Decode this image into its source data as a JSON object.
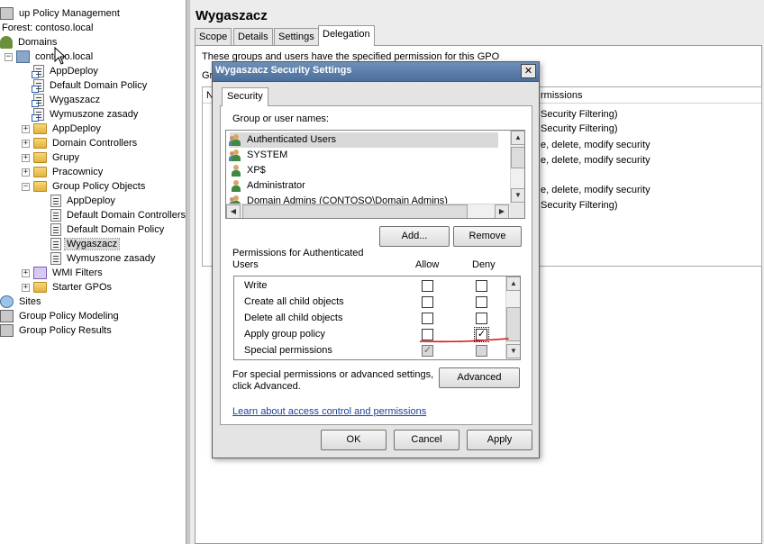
{
  "tree": [
    {
      "label": "up Policy Management",
      "icon": "gpm-icon",
      "expander": "",
      "indent": 0
    },
    {
      "label": "Forest: contoso.local",
      "icon": "",
      "expander": "",
      "indent": 0
    },
    {
      "label": "Domains",
      "icon": "domains-icon",
      "expander": "",
      "indent": 0
    },
    {
      "label": "contoso.local",
      "icon": "domain-icon",
      "expander": "−",
      "indent": 1
    },
    {
      "label": "AppDeploy",
      "icon": "gpo-link-icon",
      "expander": "",
      "indent": 2
    },
    {
      "label": "Default Domain Policy",
      "icon": "gpo-link-icon",
      "expander": "",
      "indent": 2
    },
    {
      "label": "Wygaszacz",
      "icon": "gpo-link-icon",
      "expander": "",
      "indent": 2
    },
    {
      "label": "Wymuszone zasady",
      "icon": "gpo-link-icon",
      "expander": "",
      "indent": 2
    },
    {
      "label": "AppDeploy",
      "icon": "folder-icon",
      "expander": "+",
      "indent": 2
    },
    {
      "label": "Domain Controllers",
      "icon": "folder-icon",
      "expander": "+",
      "indent": 2
    },
    {
      "label": "Grupy",
      "icon": "folder-icon",
      "expander": "+",
      "indent": 2
    },
    {
      "label": "Pracownicy",
      "icon": "folder-icon",
      "expander": "+",
      "indent": 2
    },
    {
      "label": "Group Policy Objects",
      "icon": "folder-icon",
      "expander": "−",
      "indent": 2
    },
    {
      "label": "AppDeploy",
      "icon": "gpo-icon",
      "expander": "",
      "indent": 3
    },
    {
      "label": "Default Domain Controllers",
      "icon": "gpo-icon",
      "expander": "",
      "indent": 3
    },
    {
      "label": "Default Domain Policy",
      "icon": "gpo-icon",
      "expander": "",
      "indent": 3
    },
    {
      "label": "Wygaszacz",
      "icon": "gpo-icon",
      "expander": "",
      "indent": 3,
      "selected": true
    },
    {
      "label": "Wymuszone zasady",
      "icon": "gpo-icon",
      "expander": "",
      "indent": 3
    },
    {
      "label": "WMI Filters",
      "icon": "wmi-folder-icon",
      "expander": "+",
      "indent": 2
    },
    {
      "label": "Starter GPOs",
      "icon": "folder-icon",
      "expander": "+",
      "indent": 2
    },
    {
      "label": "Sites",
      "icon": "sites-icon",
      "expander": "",
      "indent": 0
    },
    {
      "label": "Group Policy Modeling",
      "icon": "modeling-icon",
      "expander": "",
      "indent": 0
    },
    {
      "label": "Group Policy Results",
      "icon": "results-icon",
      "expander": "",
      "indent": 0
    }
  ],
  "right": {
    "title": "Wygaszacz",
    "tabs": [
      "Scope",
      "Details",
      "Settings",
      "Delegation"
    ],
    "active_tab": "Delegation",
    "delegation_text": "These groups and users have the specified permission for this GPO",
    "groups_label": "Gr",
    "header_fragment": "N",
    "permissions_header": "rmissions",
    "perm_rows": [
      "Security Filtering)",
      "Security Filtering)",
      "e, delete, modify security",
      "e, delete, modify security",
      "e, delete, modify security",
      "Security Filtering)"
    ]
  },
  "dialog": {
    "title": "Wygaszacz Security Settings",
    "close_glyph": "✕",
    "tab": "Security",
    "group_label": "Group or user names:",
    "users": [
      {
        "name": "Authenticated Users",
        "type": "group",
        "selected": true
      },
      {
        "name": "SYSTEM",
        "type": "group"
      },
      {
        "name": "XP$",
        "type": "user"
      },
      {
        "name": "Administrator",
        "type": "user"
      },
      {
        "name": "Domain Admins (CONTOSO\\Domain Admins)",
        "type": "group"
      }
    ],
    "add_button": "Add...",
    "remove_button": "Remove",
    "perm_label_line1": "Permissions for Authenticated",
    "perm_label_line2": "Users",
    "allow_header": "Allow",
    "deny_header": "Deny",
    "permissions": [
      {
        "name": "Write",
        "allow": "unchecked",
        "deny": "unchecked"
      },
      {
        "name": "Create all child objects",
        "allow": "unchecked",
        "deny": "unchecked"
      },
      {
        "name": "Delete all child objects",
        "allow": "unchecked",
        "deny": "unchecked"
      },
      {
        "name": "Apply group policy",
        "allow": "unchecked",
        "deny": "checked"
      },
      {
        "name": "Special permissions",
        "allow": "checked-disabled",
        "deny": "unchecked-disabled"
      }
    ],
    "advanced_text_line1": "For special permissions or advanced settings,",
    "advanced_text_line2": "click Advanced.",
    "advanced_button": "Advanced",
    "learn_link": "Learn about access control and permissions",
    "ok_button": "OK",
    "cancel_button": "Cancel",
    "apply_button": "Apply"
  },
  "colors": {
    "titlebar": "#5a7eab",
    "annotation_line": "#e01010",
    "link": "#1a3f9a"
  }
}
